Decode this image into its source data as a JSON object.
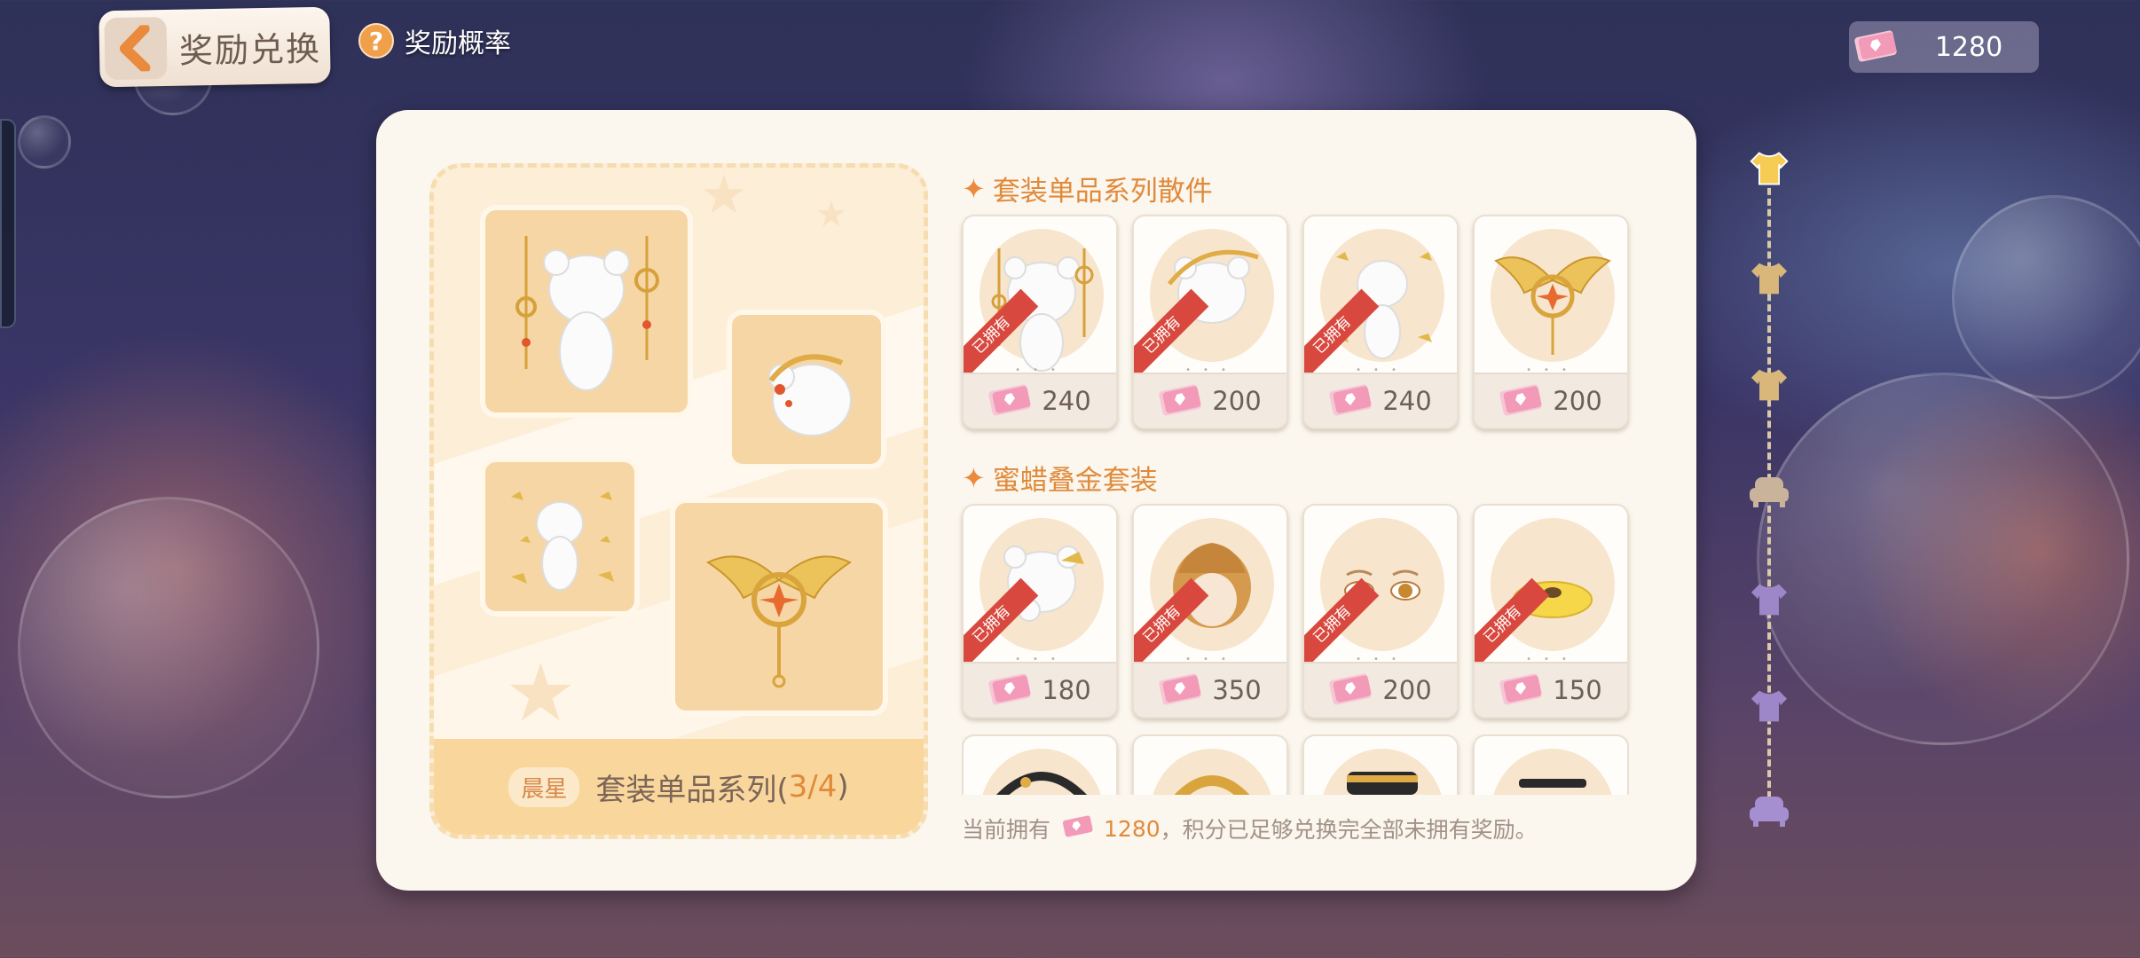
{
  "header": {
    "back_title": "奖励兑换",
    "prob_label": "奖励概率",
    "currency_value": "1280"
  },
  "showcase": {
    "tag": "晨星",
    "series_name": "套装单品系列(",
    "series_count": "3/4",
    "series_close": ")"
  },
  "sections": [
    {
      "title": "套装单品系列散件",
      "items": [
        {
          "price": "240",
          "owned": "已拥有",
          "icon": "bear-earrings-icon"
        },
        {
          "price": "200",
          "owned": "已拥有",
          "icon": "bear-headpiece-icon"
        },
        {
          "price": "240",
          "owned": "已拥有",
          "icon": "bear-sparkle-icon"
        },
        {
          "price": "200",
          "owned": "",
          "icon": "winged-pendant-icon"
        }
      ]
    },
    {
      "title": "蜜蜡叠金套装",
      "items": [
        {
          "price": "180",
          "owned": "已拥有",
          "icon": "bear-hairclip-icon"
        },
        {
          "price": "350",
          "owned": "已拥有",
          "icon": "curly-hair-icon"
        },
        {
          "price": "200",
          "owned": "已拥有",
          "icon": "eyes-makeup-icon"
        },
        {
          "price": "150",
          "owned": "已拥有",
          "icon": "bear-mouth-icon"
        }
      ]
    }
  ],
  "footer_note": {
    "prefix": "当前拥有",
    "value": "1280",
    "suffix": "，积分已足够兑换完全部未拥有奖励。"
  },
  "colors": {
    "accent": "#e08a3a",
    "panel": "#fbf6ee",
    "owned_ribbon": "#d9483e"
  }
}
